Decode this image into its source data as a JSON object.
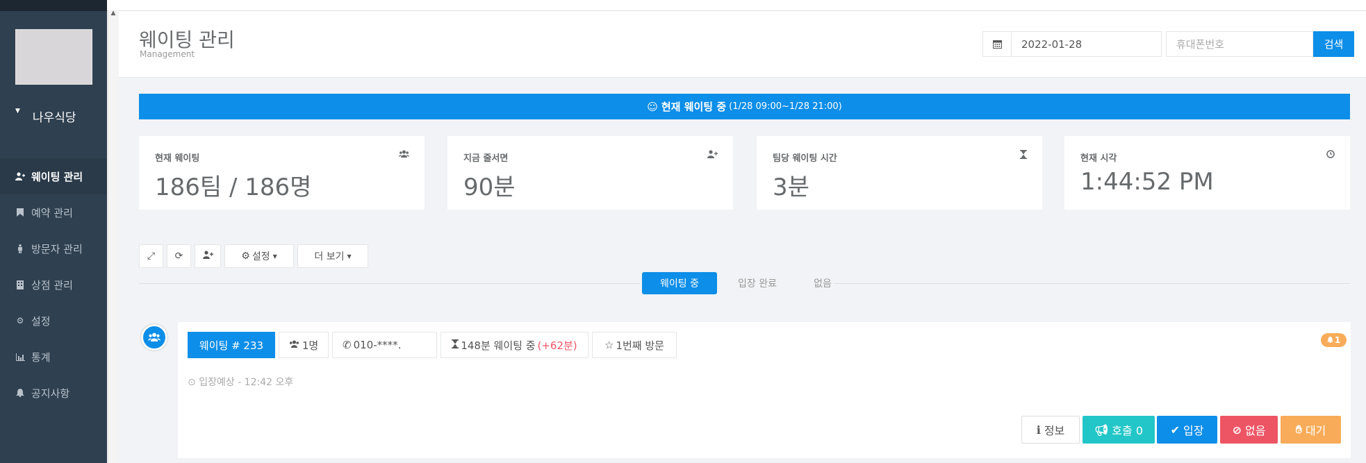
{
  "sidebar": {
    "store_name": "나우식당",
    "items": [
      {
        "label": "웨이팅 관리",
        "icon": "user-plus-icon"
      },
      {
        "label": "예약 관리",
        "icon": "bookmark-icon"
      },
      {
        "label": "방문자 관리",
        "icon": "male-icon"
      },
      {
        "label": "상점 관리",
        "icon": "building-icon"
      },
      {
        "label": "설정",
        "icon": "gear-icon"
      },
      {
        "label": "통계",
        "icon": "bar-chart-icon"
      },
      {
        "label": "공지사항",
        "icon": "bell-icon"
      }
    ]
  },
  "header": {
    "title": "웨이팅 관리",
    "subtitle": "Management",
    "date_value": "2022-01-28",
    "phone_placeholder": "휴대폰번호",
    "search_label": "검색"
  },
  "banner": {
    "text": "현재 웨이팅 중",
    "range": "(1/28 09:00~1/28 21:00)"
  },
  "stats": [
    {
      "label": "현재 웨이팅",
      "value": "186팀 / 186명",
      "icon": "users-icon"
    },
    {
      "label": "지금 줄서면",
      "value": "90분",
      "icon": "user-plus-icon"
    },
    {
      "label": "팀당 웨이팅 시간",
      "value": "3분",
      "icon": "hourglass-icon"
    },
    {
      "label": "현재 시각",
      "value": "1:44:52 PM",
      "icon": "clock-icon"
    }
  ],
  "toolbar": {
    "settings_label": "설정",
    "more_label": "더 보기"
  },
  "tabs": [
    "웨이팅 중",
    "입장 완료",
    "없음"
  ],
  "item": {
    "number_label": "웨이팅 # 233",
    "people": "1명",
    "phone": "010-****.",
    "waiting": "148분 웨이팅 중",
    "overtime": "(+62분)",
    "visit": "1번째 방문",
    "badge_count": "1",
    "eta": "입장예상 - 12:42 오후",
    "actions": {
      "info": "정보",
      "call": "호출 0",
      "enter": "입장",
      "none": "없음",
      "wait": "대기"
    }
  },
  "colors": {
    "primary": "#0d8ee8",
    "sidebar": "#2f4050",
    "call": "#23c6c8",
    "danger": "#ed5565",
    "warning": "#f8ac59"
  }
}
